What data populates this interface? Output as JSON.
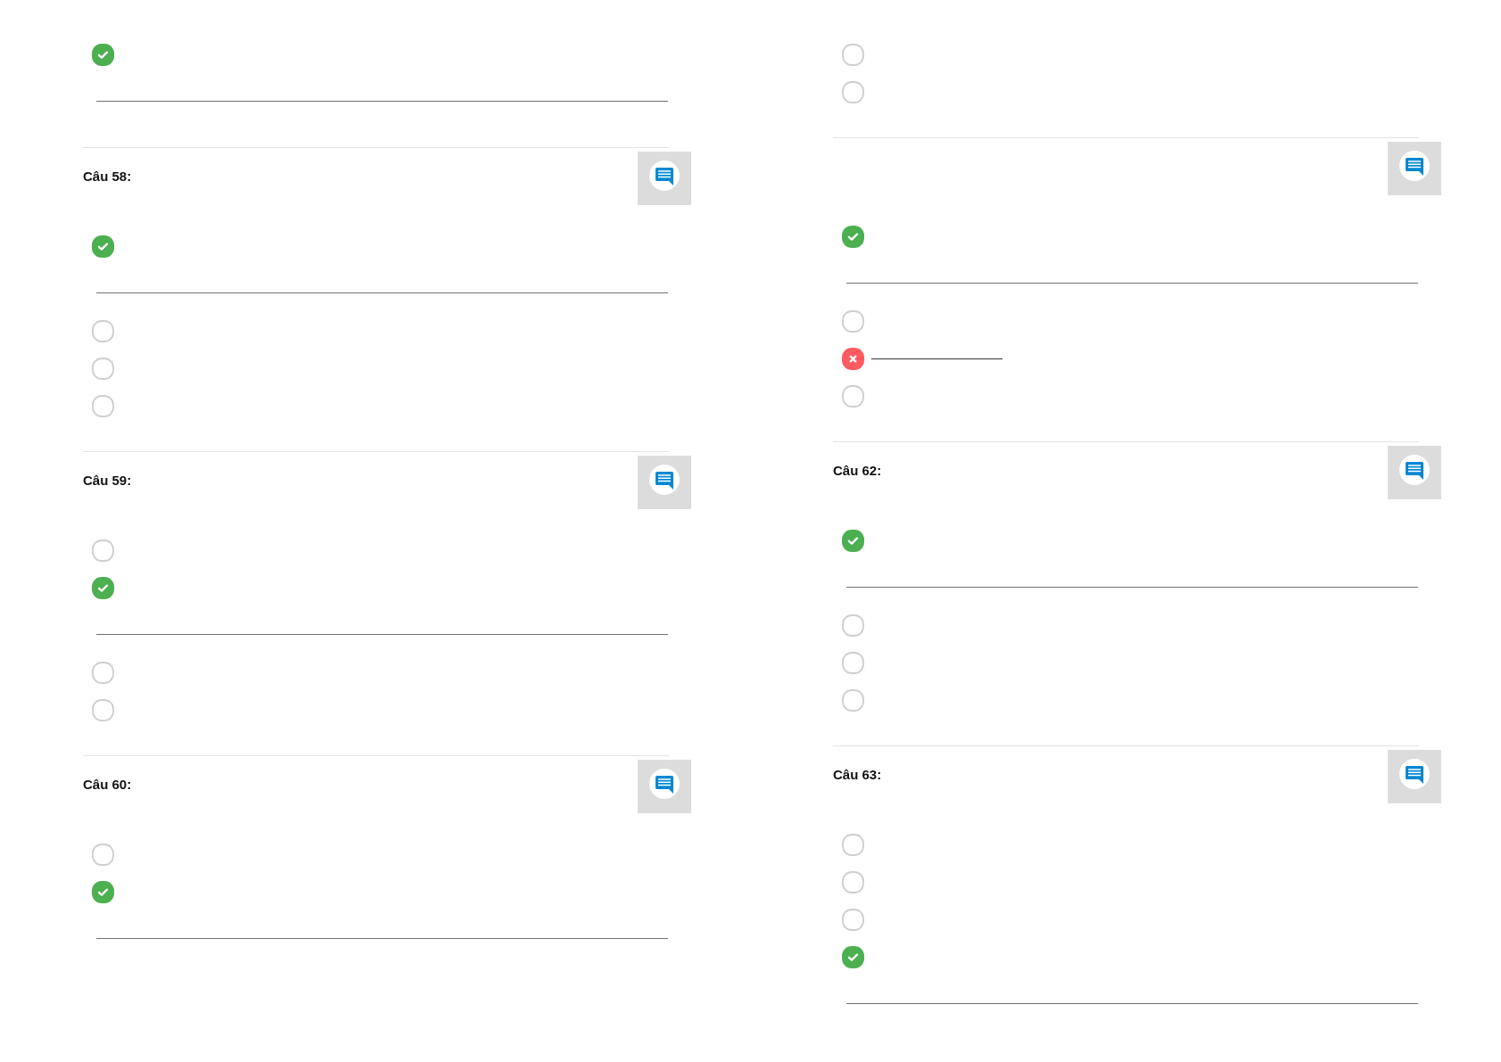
{
  "columns": [
    {
      "questions": [
        {
          "comment_button": false,
          "options": [
            {
              "kind": "correct"
            }
          ]
        },
        {
          "label": "Câu 58:",
          "comment_button": true,
          "options": [
            {
              "kind": "correct"
            },
            {
              "kind": "blank"
            },
            {
              "kind": "blank"
            },
            {
              "kind": "blank"
            }
          ]
        },
        {
          "label": "Câu 59:",
          "comment_button": true,
          "options": [
            {
              "kind": "blank"
            },
            {
              "kind": "correct"
            },
            {
              "kind": "blank"
            },
            {
              "kind": "blank"
            }
          ]
        },
        {
          "label": "Câu 60:",
          "comment_button": true,
          "options": [
            {
              "kind": "blank"
            },
            {
              "kind": "correct"
            }
          ]
        }
      ]
    },
    {
      "questions": [
        {
          "comment_button": false,
          "options": [
            {
              "kind": "blank"
            },
            {
              "kind": "blank"
            }
          ]
        },
        {
          "comment_button": true,
          "options": [
            {
              "kind": "correct"
            },
            {
              "kind": "blank"
            },
            {
              "kind": "wrong"
            },
            {
              "kind": "blank"
            }
          ]
        },
        {
          "label": "Câu 62:",
          "comment_button": true,
          "options": [
            {
              "kind": "correct"
            },
            {
              "kind": "blank"
            },
            {
              "kind": "blank"
            },
            {
              "kind": "blank"
            }
          ]
        },
        {
          "label": "Câu 63:",
          "comment_button": true,
          "options": [
            {
              "kind": "blank"
            },
            {
              "kind": "blank"
            },
            {
              "kind": "blank"
            },
            {
              "kind": "correct"
            }
          ]
        }
      ]
    }
  ]
}
